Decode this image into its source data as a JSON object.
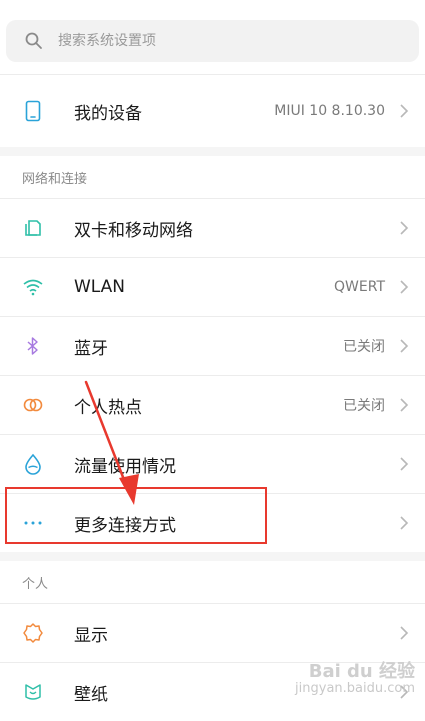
{
  "search": {
    "placeholder": "搜索系统设置项"
  },
  "device": {
    "label": "我的设备",
    "value": "MIUI 10 8.10.30"
  },
  "section_network": {
    "title": "网络和连接"
  },
  "network_items": [
    {
      "label": "双卡和移动网络",
      "value": ""
    },
    {
      "label": "WLAN",
      "value": "QWERT"
    },
    {
      "label": "蓝牙",
      "value": "已关闭"
    },
    {
      "label": "个人热点",
      "value": "已关闭"
    },
    {
      "label": "流量使用情况",
      "value": ""
    },
    {
      "label": "更多连接方式",
      "value": ""
    }
  ],
  "section_personal": {
    "title": "个人"
  },
  "personal_items": [
    {
      "label": "显示",
      "value": ""
    },
    {
      "label": "壁纸",
      "value": ""
    }
  ],
  "watermark": {
    "line1": "Bai du 经验",
    "line2": "jingyan.baidu.com"
  },
  "colors": {
    "icon_blue": "#2aa3d8",
    "icon_teal": "#2fbfa8",
    "icon_purple": "#a77ae0",
    "icon_orange": "#f28a3d",
    "highlight": "#e8392e"
  }
}
